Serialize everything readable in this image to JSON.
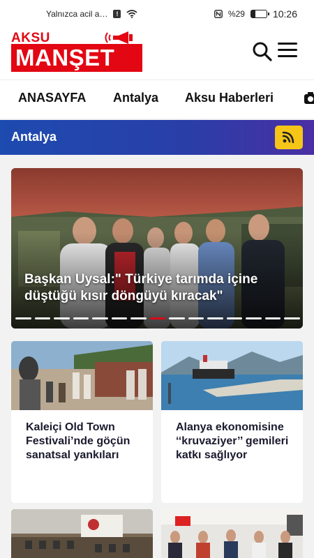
{
  "status_bar": {
    "notification": "Yalnızca acil a…",
    "battery": "%29",
    "battery_level": 0.29,
    "time": "10:26"
  },
  "header": {
    "logo_top": "AKSU",
    "logo_main": "MANŞET",
    "brand_color": "#e30613"
  },
  "nav": {
    "items": [
      {
        "label": "ANASAYFA"
      },
      {
        "label": "Antalya"
      },
      {
        "label": "Aksu Haberleri"
      }
    ]
  },
  "section": {
    "title": "Antalya",
    "rss_color": "#f5c518"
  },
  "hero": {
    "title": "Başkan Uysal:\" Türkiye tarımda içine düştüğü kısır döngüyü kıracak\"",
    "dot_count": 15,
    "active_dot": 7
  },
  "cards": [
    {
      "title": "Kaleiçi Old Town Festivali’nde göçün sanatsal yankıları"
    },
    {
      "title": "Alanya ekonomisine ‘‘kruvaziyer’’ gemileri katkı sağlıyor"
    }
  ]
}
